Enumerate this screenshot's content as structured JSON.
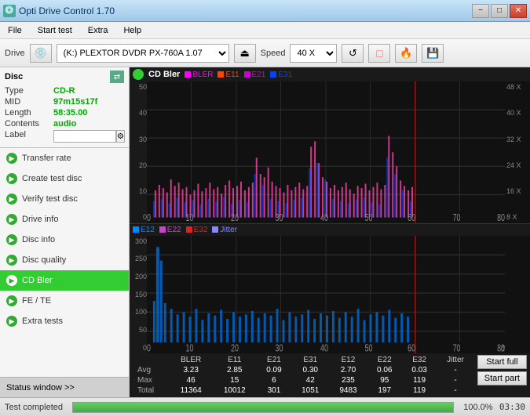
{
  "titlebar": {
    "icon": "💿",
    "title": "Opti Drive Control 1.70",
    "minimize": "−",
    "maximize": "□",
    "close": "✕"
  },
  "menubar": {
    "items": [
      {
        "label": "File"
      },
      {
        "label": "Start test"
      },
      {
        "label": "Extra"
      },
      {
        "label": "Help"
      }
    ]
  },
  "toolbar": {
    "drive_label": "Drive",
    "drive_icon": "💿",
    "drive_value": "(K:)  PLEXTOR DVDR  PX-760A 1.07",
    "eject_icon": "⏏",
    "speed_label": "Speed",
    "speed_value": "40 X",
    "refresh_icon": "↺",
    "erase_icon": "◻",
    "burn_icon": "🔥",
    "save_icon": "💾"
  },
  "sidebar": {
    "disc_title": "Disc",
    "disc_arrow": "⇄",
    "disc_fields": [
      {
        "label": "Type",
        "value": "CD-R"
      },
      {
        "label": "MID",
        "value": "97m15s17f"
      },
      {
        "label": "Length",
        "value": "58:35.00"
      },
      {
        "label": "Contents",
        "value": "audio"
      },
      {
        "label": "Label",
        "value": ""
      }
    ],
    "menu_items": [
      {
        "id": "transfer-rate",
        "label": "Transfer rate",
        "active": false
      },
      {
        "id": "create-test-disc",
        "label": "Create test disc",
        "active": false
      },
      {
        "id": "verify-test-disc",
        "label": "Verify test disc",
        "active": false
      },
      {
        "id": "drive-info",
        "label": "Drive info",
        "active": false
      },
      {
        "id": "disc-info",
        "label": "Disc info",
        "active": false
      },
      {
        "id": "disc-quality",
        "label": "Disc quality",
        "active": false
      },
      {
        "id": "cd-bler",
        "label": "CD Bler",
        "active": true
      },
      {
        "id": "fe-te",
        "label": "FE / TE",
        "active": false
      },
      {
        "id": "extra-tests",
        "label": "Extra tests",
        "active": false
      }
    ],
    "status_window": "Status window >>"
  },
  "chart": {
    "title": "CD Bler",
    "upper": {
      "legend": [
        {
          "label": "BLER",
          "color": "#ff00ff"
        },
        {
          "label": "E11",
          "color": "#ff4400"
        },
        {
          "label": "E21",
          "color": "#cc00cc"
        },
        {
          "label": "E31",
          "color": "#0044ff"
        }
      ],
      "y_max": 50,
      "x_max": 80,
      "right_labels": [
        "48 X",
        "40 X",
        "32 X",
        "24 X",
        "16 X",
        "8 X"
      ]
    },
    "lower": {
      "legend": [
        {
          "label": "E12",
          "color": "#0088ff"
        },
        {
          "label": "E22",
          "color": "#cc44cc"
        },
        {
          "label": "E32",
          "color": "#dd2222"
        },
        {
          "label": "Jitter",
          "color": "#8888ff"
        }
      ],
      "y_max": 300,
      "x_max": 80
    }
  },
  "stats": {
    "headers": [
      "",
      "BLER",
      "E11",
      "E21",
      "E31",
      "E12",
      "E22",
      "E32",
      "Jitter"
    ],
    "rows": [
      {
        "label": "Avg",
        "values": [
          "3.23",
          "2.85",
          "0.09",
          "0.30",
          "2.70",
          "0.06",
          "0.03",
          "-"
        ]
      },
      {
        "label": "Max",
        "values": [
          "46",
          "15",
          "6",
          "42",
          "235",
          "95",
          "119",
          "-"
        ]
      },
      {
        "label": "Total",
        "values": [
          "11364",
          "10012",
          "301",
          "1051",
          "9483",
          "197",
          "119",
          "-"
        ]
      }
    ],
    "buttons": [
      {
        "label": "Start full",
        "id": "start-full"
      },
      {
        "label": "Start part",
        "id": "start-part"
      }
    ]
  },
  "statusbar": {
    "text": "Test completed",
    "progress": 100.0,
    "progress_text": "100.0%",
    "time": "03:30"
  }
}
